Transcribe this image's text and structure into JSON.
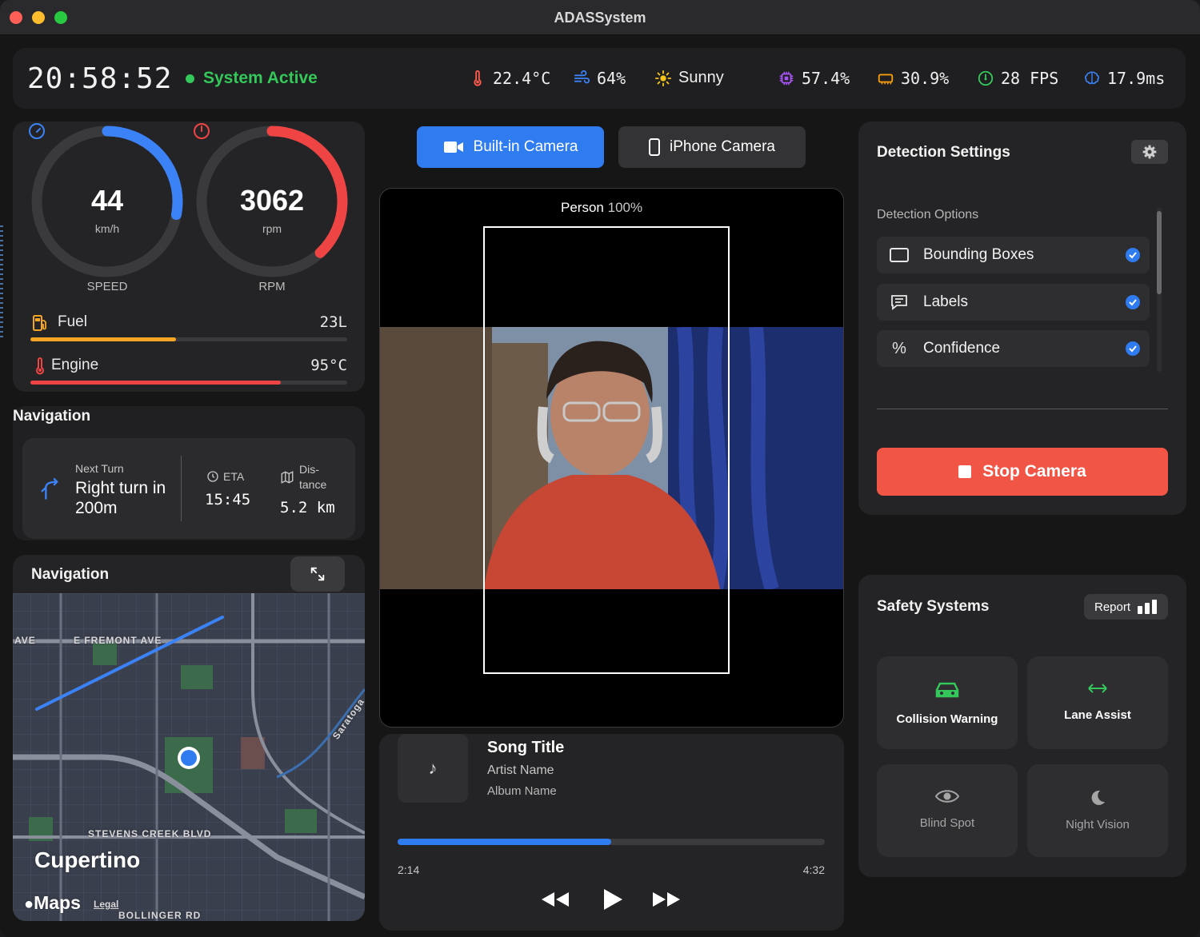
{
  "window": {
    "title": "ADASSystem"
  },
  "status": {
    "time": "20:58:52",
    "system": "System Active",
    "temperature": "22.4°C",
    "humidity": "64%",
    "weather": "Sunny",
    "cpu": "57.4%",
    "memory": "30.9%",
    "fps": "28 FPS",
    "latency": "17.9ms"
  },
  "gauges": {
    "speed": {
      "value": "44",
      "unit": "km/h",
      "label": "SPEED",
      "fraction": 0.28,
      "color": "#3b82f6"
    },
    "rpm": {
      "value": "3062",
      "unit": "rpm",
      "label": "RPM",
      "fraction": 0.38,
      "color": "#ef4444"
    },
    "fuel": {
      "label": "Fuel",
      "value": "23L",
      "fraction": 0.46,
      "color": "#f5a524"
    },
    "engine": {
      "label": "Engine",
      "value": "95°C",
      "fraction": 0.79,
      "color": "#ef4444"
    }
  },
  "navigation": {
    "title": "Navigation",
    "next_turn_label": "Next Turn",
    "turn_desc": "Right turn in 200m",
    "eta_label": "ETA",
    "eta": "15:45",
    "distance_label": "Dis- tance",
    "distance": "5.2 km"
  },
  "map": {
    "title": "Navigation",
    "labels": {
      "ave": "AVE",
      "fremont": "E FREMONT AVE",
      "saratoga": "Saratoga",
      "stevens": "STEVENS CREEK BLVD",
      "city": "Cupertino",
      "maps": "Maps",
      "legal": "Legal",
      "bollinger": "BOLLINGER RD"
    }
  },
  "camera": {
    "builtin_label": "Built-in Camera",
    "iphone_label": "iPhone Camera",
    "detection_class": "Person",
    "detection_conf": "100%"
  },
  "music": {
    "title": "Song Title",
    "artist": "Artist Name",
    "album": "Album Name",
    "current": "2:14",
    "total": "4:32",
    "progress": 0.5
  },
  "detection": {
    "title": "Detection Settings",
    "options_header": "Detection Options",
    "options": [
      {
        "label": "Bounding Boxes",
        "checked": true
      },
      {
        "label": "Labels",
        "checked": true
      },
      {
        "label": "Confidence",
        "checked": true
      }
    ],
    "stop_label": "Stop Camera"
  },
  "safety": {
    "title": "Safety Systems",
    "report_label": "Report",
    "tiles": [
      {
        "label": "Collision Warning",
        "active": true,
        "color": "#34c759"
      },
      {
        "label": "Lane Assist",
        "active": true,
        "color": "#34c759"
      },
      {
        "label": "Blind Spot",
        "active": false,
        "color": "#a5a5a5"
      },
      {
        "label": "Night Vision",
        "active": false,
        "color": "#a5a5a5"
      }
    ]
  }
}
